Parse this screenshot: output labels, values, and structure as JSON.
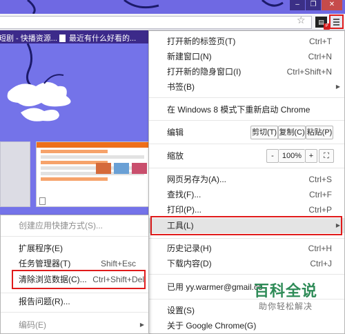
{
  "window": {
    "min": "–",
    "max": "❐",
    "close": "✕"
  },
  "bookmarks": [
    {
      "label": "短剧 - 快播资源..."
    },
    {
      "label": "最近有什么好看的..."
    }
  ],
  "main_menu": {
    "new_tab": {
      "label": "打开新的标签页(T)",
      "shortcut": "Ctrl+T"
    },
    "new_window": {
      "label": "新建窗口(N)",
      "shortcut": "Ctrl+N"
    },
    "incognito": {
      "label": "打开新的隐身窗口(I)",
      "shortcut": "Ctrl+Shift+N"
    },
    "bookmarks": {
      "label": "书签(B)"
    },
    "win8": {
      "label": "在 Windows 8 模式下重新启动 Chrome"
    },
    "edit": {
      "label": "编辑",
      "cut": "剪切(T)",
      "copy": "复制(C)",
      "paste": "粘贴(P)"
    },
    "zoom": {
      "label": "缩放",
      "minus": "-",
      "value": "100%",
      "plus": "+"
    },
    "save_as": {
      "label": "网页另存为(A)...",
      "shortcut": "Ctrl+S"
    },
    "find": {
      "label": "查找(F)...",
      "shortcut": "Ctrl+F"
    },
    "print": {
      "label": "打印(P)...",
      "shortcut": "Ctrl+P"
    },
    "tools": {
      "label": "工具(L)"
    },
    "history": {
      "label": "历史记录(H)",
      "shortcut": "Ctrl+H"
    },
    "downloads": {
      "label": "下载内容(D)",
      "shortcut": "Ctrl+J"
    },
    "signed_in": {
      "label": "已用 yy.warmer@gmail.co"
    },
    "settings": {
      "label": "设置(S)"
    },
    "about": {
      "label": "关于 Google Chrome(G)"
    }
  },
  "tools_submenu": {
    "create_shortcuts": {
      "label": "创建应用快捷方式(S)..."
    },
    "extensions": {
      "label": "扩展程序(E)"
    },
    "task_manager": {
      "label": "任务管理器(T)",
      "shortcut": "Shift+Esc"
    },
    "clear_data": {
      "label": "清除浏览数据(C)...",
      "shortcut": "Ctrl+Shift+Del"
    },
    "report_issue": {
      "label": "报告问题(R)..."
    },
    "encoding": {
      "label": "编码(E)"
    }
  },
  "watermark": {
    "title": "百科全说",
    "subtitle": "助你轻松解决"
  },
  "colors": {
    "accent_red": "#e01a1a",
    "theme_purple": "#6f69e3",
    "bookmark_bar": "#3c2a8a"
  }
}
